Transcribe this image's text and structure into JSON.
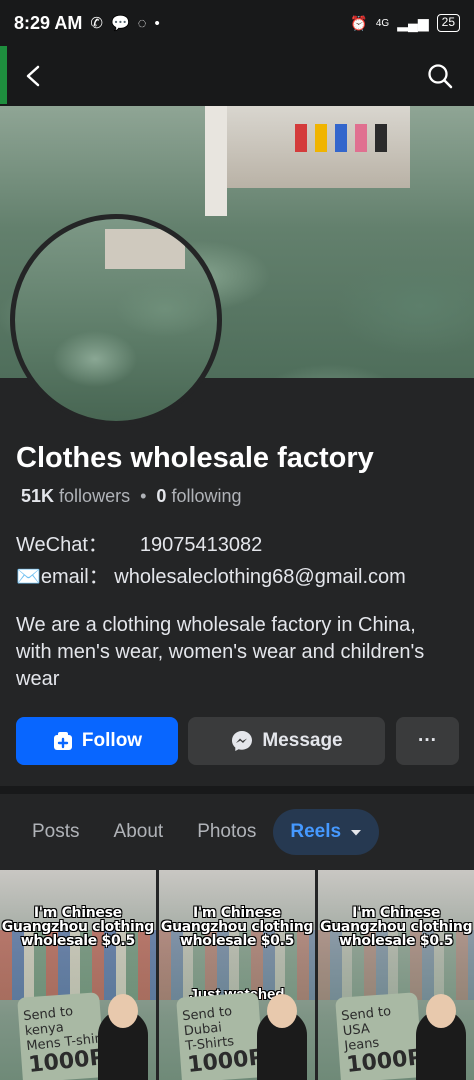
{
  "status_bar": {
    "time": "8:29 AM",
    "network": "4G",
    "battery": "25"
  },
  "header": {
    "back_icon": "arrow-left-icon",
    "search_icon": "search-icon"
  },
  "profile": {
    "name": "Clothes wholesale factory",
    "followers_count": "51K",
    "followers_label": "followers",
    "separator": "•",
    "following_count": "0",
    "following_label": "following",
    "wechat_label": "WeChat：",
    "wechat_value": "19075413082",
    "email_label": "✉️email：",
    "email_value": "wholesaleclothing68@gmail.com",
    "bio": "We are a clothing wholesale factory in China, with men's wear, women's wear and children's wear"
  },
  "actions": {
    "follow_label": "Follow",
    "message_label": "Message",
    "more_label": "···"
  },
  "tabs": [
    {
      "label": "Posts",
      "active": false
    },
    {
      "label": "About",
      "active": false
    },
    {
      "label": "Photos",
      "active": false
    },
    {
      "label": "Reels",
      "active": true
    }
  ],
  "reels": [
    {
      "caption_1": "I'm Chinese",
      "caption_2": "Guangzhou clothing",
      "caption_3": "wholesale $0.5",
      "bag_line_1": "Send to kenya",
      "bag_line_2": "Mens T-shirt",
      "bag_big": "1000Pcs",
      "overlay": ""
    },
    {
      "caption_1": "I'm Chinese",
      "caption_2": "Guangzhou clothing",
      "caption_3": "wholesale $0.5",
      "bag_line_1": "Send to Dubai",
      "bag_line_2": "T-Shirts",
      "bag_big": "1000Pcs",
      "overlay": "Just watched"
    },
    {
      "caption_1": "I'm Chinese",
      "caption_2": "Guangzhou clothing",
      "caption_3": "wholesale $0.5",
      "bag_line_1": "Send to USA",
      "bag_line_2": "Jeans",
      "bag_big": "1000Pcs",
      "overlay": ""
    }
  ],
  "colors": {
    "background": "#242526",
    "accent": "#0866ff",
    "active_tab_bg": "#263951",
    "active_tab_text": "#4599ff"
  }
}
